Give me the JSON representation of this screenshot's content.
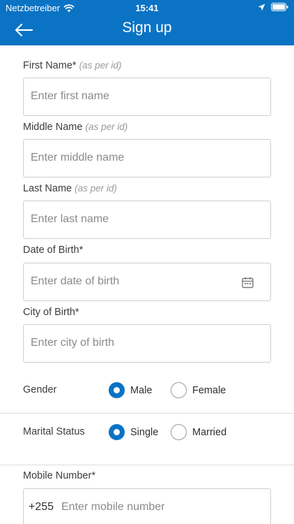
{
  "status_bar": {
    "carrier": "Netzbetreiber",
    "time": "15:41"
  },
  "nav": {
    "title": "Sign up"
  },
  "fields": {
    "first_name": {
      "label": "First Name*",
      "hint": "(as per id)",
      "placeholder": "Enter first name"
    },
    "middle_name": {
      "label": "Middle Name",
      "hint": "(as per id)",
      "placeholder": "Enter middle name"
    },
    "last_name": {
      "label": "Last Name",
      "hint": "(as per id)",
      "placeholder": "Enter last name"
    },
    "dob": {
      "label": "Date of Birth*",
      "placeholder": "Enter date of birth"
    },
    "city_of_birth": {
      "label": "City of Birth*",
      "placeholder": "Enter city of birth"
    },
    "mobile": {
      "label": "Mobile Number*",
      "prefix": "+255",
      "placeholder": "Enter mobile number"
    }
  },
  "gender": {
    "label": "Gender",
    "options": [
      "Male",
      "Female"
    ],
    "selected": "Male"
  },
  "marital_status": {
    "label": "Marital Status",
    "options": [
      "Single",
      "Married"
    ],
    "selected": "Single"
  },
  "colors": {
    "primary": "#0a73c4",
    "border": "#cfcfcf",
    "placeholder": "#8a8a8a"
  },
  "icons": [
    "wifi-icon",
    "location-arrow-icon",
    "battery-icon",
    "back-arrow-icon",
    "calendar-icon"
  ]
}
